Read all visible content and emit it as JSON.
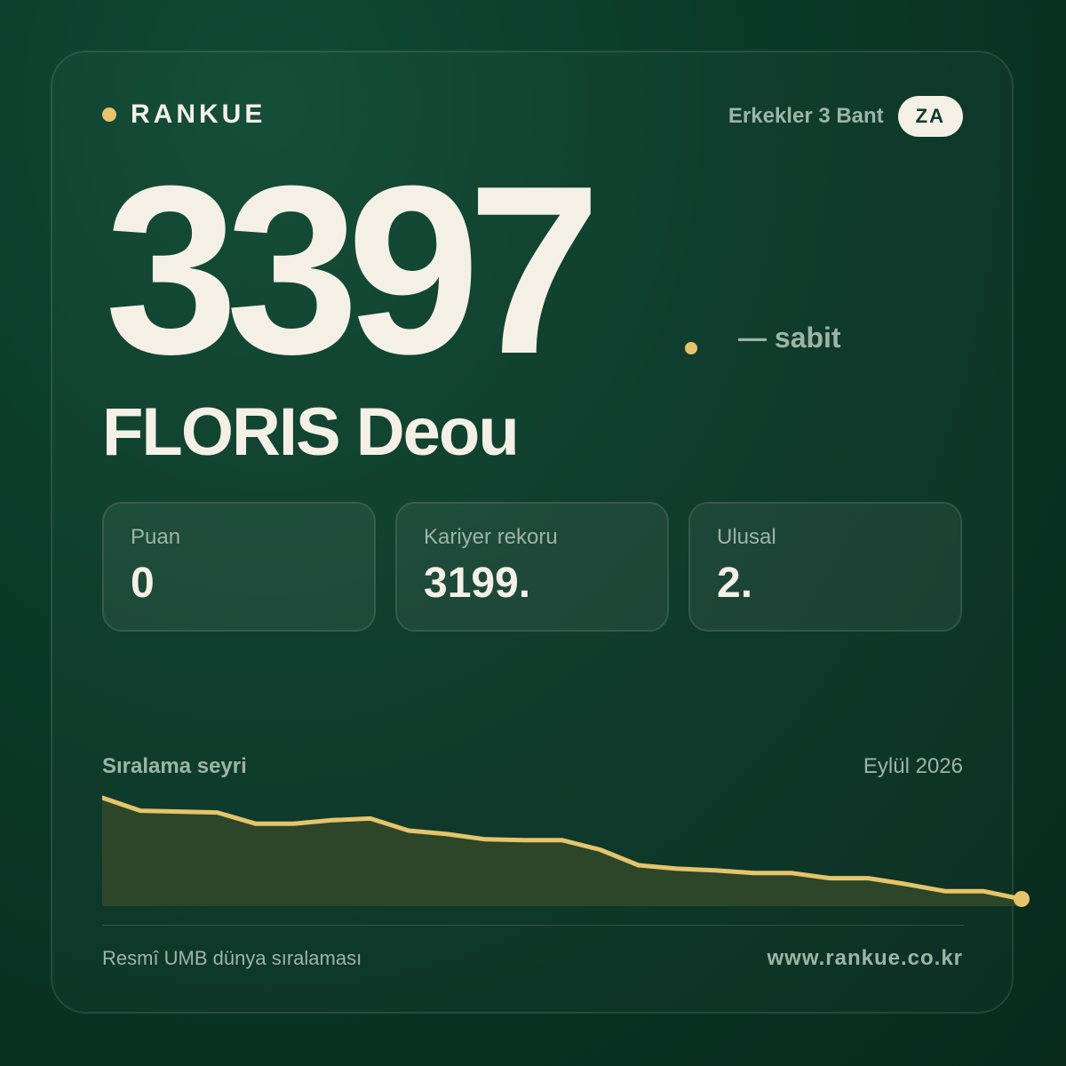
{
  "brand": {
    "name": "RANKUE",
    "dot_color": "#e6c46b"
  },
  "header": {
    "category": "Erkekler 3 Bant",
    "country": "ZA"
  },
  "ranking": {
    "position": "3397",
    "trend": "— sabit",
    "accent": "#e6c46b"
  },
  "player": {
    "name": "FLORIS Deou"
  },
  "stats": [
    {
      "label": "Puan",
      "value": "0"
    },
    {
      "label": "Kariyer rekoru",
      "value": "3199."
    },
    {
      "label": "Ulusal",
      "value": "2."
    }
  ],
  "chart": {
    "title": "Sıralama seyri",
    "date": "Eylül 2026"
  },
  "chart_data": {
    "type": "area",
    "title": "Sıralama seyri",
    "x_label_end": "Eylül 2026",
    "y_inverted": true,
    "values": [
      3280,
      3295,
      3296,
      3297,
      3310,
      3310,
      3306,
      3304,
      3318,
      3322,
      3328,
      3329,
      3329,
      3340,
      3358,
      3362,
      3364,
      3367,
      3367,
      3373,
      3373,
      3380,
      3388,
      3388,
      3397
    ],
    "line_color": "#e6c46b",
    "fill_color": "#2d4629"
  },
  "footer": {
    "source": "Resmî UMB dünya sıralaması",
    "url": "www.rankue.co.kr"
  }
}
